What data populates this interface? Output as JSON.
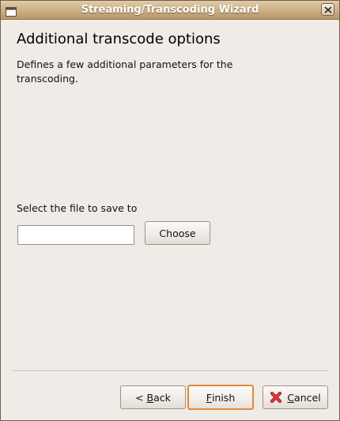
{
  "window": {
    "title": "Streaming/Transcoding Wizard"
  },
  "page": {
    "heading": "Additional transcode options",
    "description": "Defines a few additional parameters for the transcoding."
  },
  "save_file": {
    "label": "Select the file to save to",
    "value": "",
    "choose_label": "Choose"
  },
  "buttons": {
    "back": {
      "prefix": "< ",
      "mnemonic": "B",
      "rest": "ack"
    },
    "finish": {
      "mnemonic": "F",
      "rest": "inish"
    },
    "cancel": {
      "mnemonic": "C",
      "rest": "ancel",
      "icon": "cancel-x-icon"
    }
  },
  "colors": {
    "titlebar": "#cfb48a",
    "background": "#efebe7",
    "default_button_border": "#e08a3c",
    "cancel_icon": "#d32f2f"
  }
}
